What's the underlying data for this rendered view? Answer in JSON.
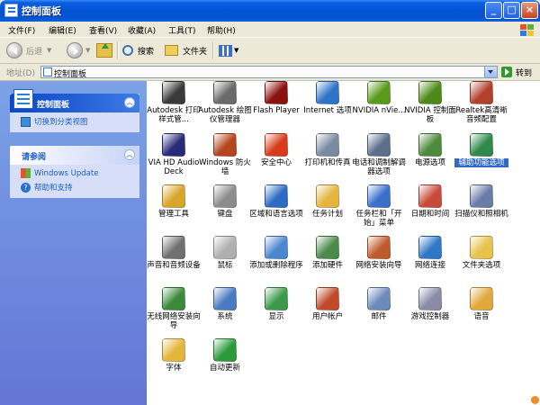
{
  "window": {
    "title": "控制面板"
  },
  "menu": [
    "文件(F)",
    "编辑(E)",
    "查看(V)",
    "收藏(A)",
    "工具(T)",
    "帮助(H)"
  ],
  "toolbar": {
    "back": "后退",
    "search": "搜索",
    "folders": "文件夹"
  },
  "address": {
    "label": "地址(D)",
    "value": "控制面板",
    "go": "转到"
  },
  "sidebar": {
    "panel1": {
      "title": "控制面板",
      "link": "切换到分类视图"
    },
    "panel2": {
      "title": "请参阅",
      "links": [
        "Windows Update",
        "帮助和支持"
      ]
    }
  },
  "items": [
    {
      "label": "Autodesk 打印样式管...",
      "icon": "printer-style-icon",
      "color": "#3a3a3a"
    },
    {
      "label": "Autodesk 绘图仪管理器",
      "icon": "plotter-icon",
      "color": "#6a6a6a"
    },
    {
      "label": "Flash Player",
      "icon": "flash-icon",
      "color": "#8b1010"
    },
    {
      "label": "Internet 选项",
      "icon": "internet-options-icon",
      "color": "#2f73c9"
    },
    {
      "label": "NVIDIA nVie...",
      "icon": "nvidia-icon",
      "color": "#5a9a1a"
    },
    {
      "label": "NVIDIA 控制面板",
      "icon": "nvidia-control-icon",
      "color": "#4c8a18"
    },
    {
      "label": "Realtek高清晰音频配置",
      "icon": "speaker-icon",
      "color": "#b3402c"
    },
    {
      "label": "VIA HD Audio Deck",
      "icon": "vinyl-icon",
      "color": "#2a2a7a"
    },
    {
      "label": "Windows 防火墙",
      "icon": "firewall-icon",
      "color": "#b5451c"
    },
    {
      "label": "安全中心",
      "icon": "shield-icon",
      "color": "#d83a1a"
    },
    {
      "label": "打印机和传真",
      "icon": "printer-icon",
      "color": "#7a8aa3"
    },
    {
      "label": "电话和调制解调器选项",
      "icon": "phone-icon",
      "color": "#5b6f8a"
    },
    {
      "label": "电源选项",
      "icon": "power-icon",
      "color": "#4d8a3a"
    },
    {
      "label": "辅助功能选项",
      "icon": "accessibility-icon",
      "color": "#2f8a4a"
    },
    {
      "label": "管理工具",
      "icon": "admin-tools-icon",
      "color": "#d9a52b"
    },
    {
      "label": "键盘",
      "icon": "keyboard-icon",
      "color": "#8d8d8d"
    },
    {
      "label": "区域和语言选项",
      "icon": "globe-icon",
      "color": "#2b6bc2"
    },
    {
      "label": "任务计划",
      "icon": "scheduled-tasks-icon",
      "color": "#e5b63e"
    },
    {
      "label": "任务栏和「开始」菜单",
      "icon": "taskbar-icon",
      "color": "#3a6fcc"
    },
    {
      "label": "日期和时间",
      "icon": "clock-icon",
      "color": "#c94a3a"
    },
    {
      "label": "扫描仪和照相机",
      "icon": "scanner-icon",
      "color": "#6a7ca8"
    },
    {
      "label": "声音和音频设备",
      "icon": "sound-icon",
      "color": "#707070"
    },
    {
      "label": "鼠标",
      "icon": "mouse-icon",
      "color": "#b0b0b0"
    },
    {
      "label": "添加或删除程序",
      "icon": "add-remove-icon",
      "color": "#4a87d0"
    },
    {
      "label": "添加硬件",
      "icon": "add-hardware-icon",
      "color": "#4a8a4a"
    },
    {
      "label": "网络安装向导",
      "icon": "network-wizard-icon",
      "color": "#c05a2a"
    },
    {
      "label": "网络连接",
      "icon": "network-icon",
      "color": "#2e78c7"
    },
    {
      "label": "文件夹选项",
      "icon": "folder-options-icon",
      "color": "#e8c24a"
    },
    {
      "label": "无线网络安装向导",
      "icon": "wireless-icon",
      "color": "#3a8a3a"
    },
    {
      "label": "系统",
      "icon": "system-icon",
      "color": "#4a7ac2"
    },
    {
      "label": "显示",
      "icon": "display-icon",
      "color": "#3a9a4a"
    },
    {
      "label": "用户帐户",
      "icon": "users-icon",
      "color": "#c04a2a"
    },
    {
      "label": "邮件",
      "icon": "mail-icon",
      "color": "#6a8aba"
    },
    {
      "label": "游戏控制器",
      "icon": "gamepad-icon",
      "color": "#8a8aa8"
    },
    {
      "label": "语音",
      "icon": "speech-icon",
      "color": "#e0a83a"
    },
    {
      "label": "字体",
      "icon": "fonts-icon",
      "color": "#e3b53b"
    },
    {
      "label": "自动更新",
      "icon": "windows-update-icon",
      "color": "#2a9a3a"
    }
  ]
}
